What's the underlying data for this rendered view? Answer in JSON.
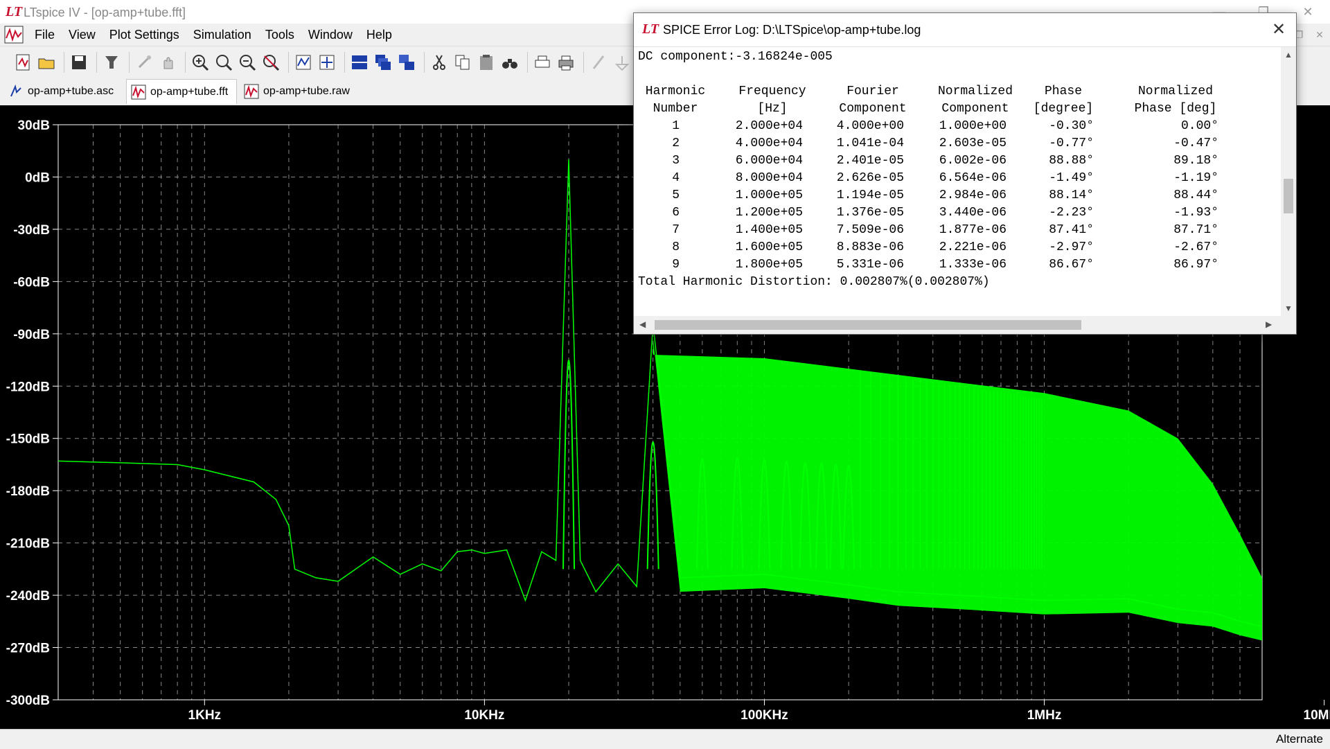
{
  "app": {
    "title": "LTspice IV - [op-amp+tube.fft]",
    "menu": [
      "File",
      "View",
      "Plot Settings",
      "Simulation",
      "Tools",
      "Window",
      "Help"
    ],
    "tabs": [
      {
        "label": "op-amp+tube.asc",
        "icon": "schematic-icon"
      },
      {
        "label": "op-amp+tube.fft",
        "icon": "waveform-icon"
      },
      {
        "label": "op-amp+tube.raw",
        "icon": "waveform-icon"
      }
    ],
    "status": "Alternate"
  },
  "log": {
    "title": "SPICE Error Log: D:\\LTSpice\\op-amp+tube.log",
    "dc": "DC component:-3.16824e-005",
    "headers": {
      "row1": [
        "Harmonic",
        "Frequency",
        "Fourier",
        "Normalized",
        "Phase",
        "Normalized"
      ],
      "row2": [
        "Number",
        "[Hz]",
        "Component",
        "Component",
        "[degree]",
        "Phase [deg]"
      ]
    },
    "rows": [
      [
        "1",
        "2.000e+04",
        "4.000e+00",
        "1.000e+00",
        "-0.30°",
        "0.00°"
      ],
      [
        "2",
        "4.000e+04",
        "1.041e-04",
        "2.603e-05",
        "-0.77°",
        "-0.47°"
      ],
      [
        "3",
        "6.000e+04",
        "2.401e-05",
        "6.002e-06",
        "88.88°",
        "89.18°"
      ],
      [
        "4",
        "8.000e+04",
        "2.626e-05",
        "6.564e-06",
        "-1.49°",
        "-1.19°"
      ],
      [
        "5",
        "1.000e+05",
        "1.194e-05",
        "2.984e-06",
        "88.14°",
        "88.44°"
      ],
      [
        "6",
        "1.200e+05",
        "1.376e-05",
        "3.440e-06",
        "-2.23°",
        "-1.93°"
      ],
      [
        "7",
        "1.400e+05",
        "7.509e-06",
        "1.877e-06",
        "87.41°",
        "87.71°"
      ],
      [
        "8",
        "1.600e+05",
        "8.883e-06",
        "2.221e-06",
        "-2.97°",
        "-2.67°"
      ],
      [
        "9",
        "1.800e+05",
        "5.331e-06",
        "1.333e-06",
        "86.67°",
        "86.97°"
      ]
    ],
    "thd": "Total Harmonic Distortion: 0.002807%(0.002807%)"
  },
  "chart_data": {
    "type": "line",
    "xlabel": "",
    "ylabel": "",
    "x_scale": "log",
    "xlim": [
      300,
      6000000
    ],
    "ylim": [
      -300,
      30
    ],
    "x_ticks": [
      {
        "value": 1000,
        "label": "1KHz"
      },
      {
        "value": 10000,
        "label": "10KHz"
      },
      {
        "value": 100000,
        "label": "100KHz"
      },
      {
        "value": 1000000,
        "label": "1MHz"
      },
      {
        "value": 10000000,
        "label": "10MHz"
      }
    ],
    "y_ticks": [
      {
        "value": 30,
        "label": "30dB"
      },
      {
        "value": 0,
        "label": "0dB"
      },
      {
        "value": -30,
        "label": "-30dB"
      },
      {
        "value": -60,
        "label": "-60dB"
      },
      {
        "value": -90,
        "label": "-90dB"
      },
      {
        "value": -120,
        "label": "-120dB"
      },
      {
        "value": -150,
        "label": "-150dB"
      },
      {
        "value": -180,
        "label": "-180dB"
      },
      {
        "value": -210,
        "label": "-210dB"
      },
      {
        "value": -240,
        "label": "-240dB"
      },
      {
        "value": -270,
        "label": "-270dB"
      },
      {
        "value": -300,
        "label": "-300dB"
      }
    ],
    "grid": true,
    "series_color": "#00ff00",
    "series": [
      {
        "x": [
          300,
          500,
          800,
          1000,
          1500,
          1800,
          2000,
          2100,
          2500,
          3000,
          4000,
          5000,
          6000,
          7000,
          8000,
          9000,
          10000,
          12000,
          14000,
          16000,
          18000,
          20000,
          22000,
          25000,
          30000,
          35000,
          40000,
          50000,
          100000,
          200000,
          300000,
          500000,
          1000000,
          2000000,
          3000000,
          4000000,
          5000000,
          6000000
        ],
        "y": [
          -163,
          -164,
          -165,
          -168,
          -175,
          -185,
          -200,
          -225,
          -230,
          -232,
          -218,
          -228,
          -222,
          -226,
          -215,
          -214,
          -216,
          -214,
          -243,
          -215,
          -220,
          10,
          -220,
          -238,
          -222,
          -235,
          -84,
          -230,
          -228,
          -234,
          -238,
          -240,
          -243,
          -242,
          -248,
          -250,
          -255,
          -258
        ]
      }
    ],
    "harmonic_peaks": [
      {
        "f": 20000,
        "db": 10
      },
      {
        "f": 40000,
        "db": -84
      },
      {
        "f": 60000,
        "db": -103
      },
      {
        "f": 80000,
        "db": -102
      },
      {
        "f": 100000,
        "db": -104
      },
      {
        "f": 120000,
        "db": -106
      },
      {
        "f": 140000,
        "db": -108
      },
      {
        "f": 160000,
        "db": -108
      },
      {
        "f": 180000,
        "db": -110
      },
      {
        "f": 200000,
        "db": -111
      }
    ],
    "envelope": {
      "x": [
        40000,
        100000,
        200000,
        500000,
        1000000,
        2000000,
        3000000,
        4000000,
        5000000,
        6000000
      ],
      "y": [
        -102,
        -104,
        -110,
        -118,
        -124,
        -134,
        -150,
        -176,
        -205,
        -230
      ]
    }
  }
}
